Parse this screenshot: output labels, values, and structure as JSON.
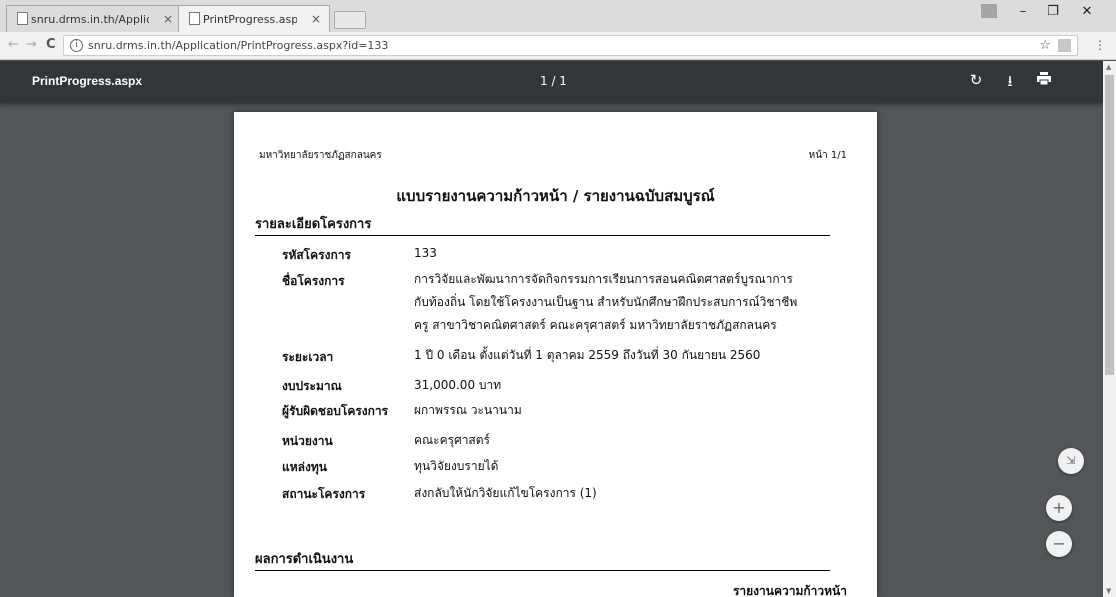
{
  "browser": {
    "tabs": [
      {
        "title": "snru.drms.in.th/Applicati",
        "close": "×"
      },
      {
        "title": "PrintProgress.aspx",
        "close": "×"
      }
    ],
    "window_controls": {
      "minimize": "–",
      "maximize": "❐",
      "close": "✕"
    },
    "nav": {
      "back": "←",
      "forward": "→",
      "reload": "C"
    },
    "url": "snru.drms.in.th/Application/PrintProgress.aspx?id=133",
    "star": "☆",
    "menu": "⋮"
  },
  "pdf_viewer": {
    "title": "PrintProgress.aspx",
    "page_indicator": "1 / 1",
    "rotate": "↻",
    "download": "⭳",
    "print": "🖶"
  },
  "document": {
    "header_left": "มหาวิทยาลัยราชภัฏสกลนคร",
    "header_right": "หน้า 1/1",
    "title": "แบบรายงานความก้าวหน้า / รายงานฉบับสมบูรณ์",
    "section_details": "รายละเอียดโครงการ",
    "fields": [
      {
        "label": "รหัสโครงการ",
        "value": "133"
      },
      {
        "label": "ชื่อโครงการ",
        "value": "การวิจัยและพัฒนาการจัดกิจกรรมการเรียนการสอนคณิตศาสตร์บูรณาการ",
        "value2": "กับท้องถิ่น โดยใช้โครงงานเป็นฐาน สำหรับนักศึกษาฝึกประสบการณ์วิชาชีพ",
        "value3": "ครู สาขาวิชาคณิตศาสตร์ คณะครุศาสตร์ มหาวิทยาลัยราชภัฏสกลนคร"
      },
      {
        "label": "ระยะเวลา",
        "value": "1 ปี 0 เดือน ตั้งแต่วันที่ 1 ตุลาคม 2559 ถึงวันที่ 30 กันยายน 2560"
      },
      {
        "label": "งบประมาณ",
        "value": "31,000.00 บาท"
      },
      {
        "label": "ผู้รับผิดชอบโครงการ",
        "value": "ผกาพรรณ วะนานาม"
      },
      {
        "label": "หน่วยงาน",
        "value": "คณะครุศาสตร์"
      },
      {
        "label": "แหล่งทุน",
        "value": "ทุนวิจัยงบรายได้"
      },
      {
        "label": "สถานะโครงการ",
        "value": "ส่งกลับให้นักวิจัยแก้ไขโครงการ (1)"
      }
    ],
    "section_results": "ผลการดำเนินงาน",
    "progress_caption": "รายงานความก้าวหน้า"
  },
  "zoom": {
    "fit": "⇲",
    "in": "+",
    "out": "−"
  }
}
